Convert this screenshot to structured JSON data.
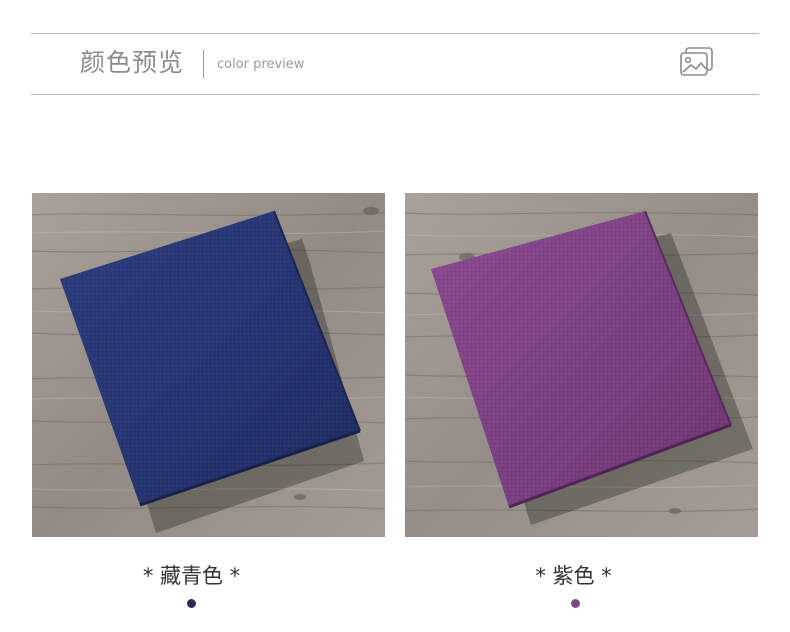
{
  "header": {
    "title_cn": "颜色预览",
    "title_en": "color preview",
    "icon": "picture-icon"
  },
  "variants": [
    {
      "caption": "* 藏青色 *",
      "color": "#2c3a78",
      "dot_color": "#26304f"
    },
    {
      "caption": "* 紫色 *",
      "color": "#7a3f80",
      "dot_color": "#7b4b82"
    }
  ],
  "colors": {
    "divider": "#b8b8b8",
    "header_text": "#8c8c8c",
    "wood": "#9a948c"
  }
}
